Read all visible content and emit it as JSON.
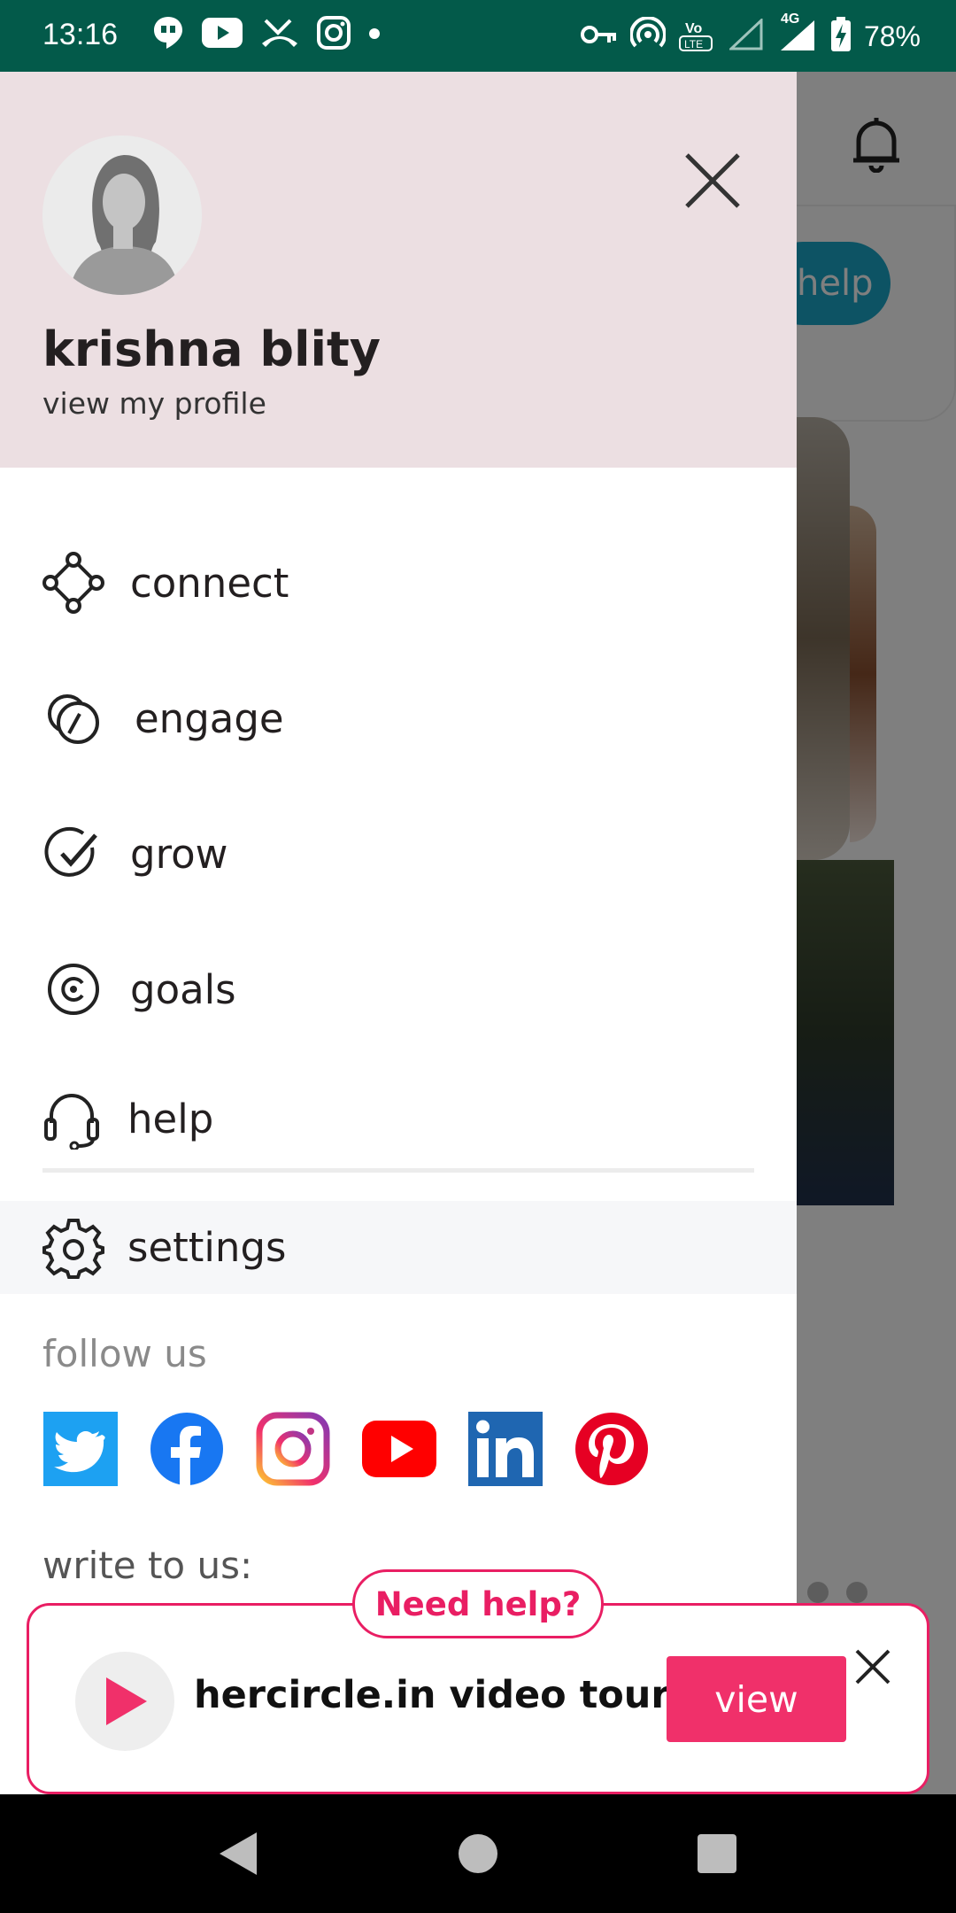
{
  "status_bar": {
    "time": "13:16",
    "battery_percent": "78%",
    "network_label": "4G",
    "left_icons": [
      "hangouts-icon",
      "youtube-icon",
      "missed-call-icon",
      "instagram-icon",
      "dot-icon"
    ],
    "right_icons": [
      "vpn-key-icon",
      "hotspot-icon",
      "volte-icon",
      "signal-icon",
      "signal-4g-icon",
      "battery-charging-icon"
    ]
  },
  "background": {
    "help_pill": "help",
    "header_icons": [
      "search-icon",
      "bell-icon"
    ]
  },
  "drawer": {
    "user_name": "krishna blity",
    "view_profile": "view my profile",
    "menu": [
      {
        "label": "connect",
        "icon": "connect-icon"
      },
      {
        "label": "engage",
        "icon": "engage-icon"
      },
      {
        "label": "grow",
        "icon": "grow-icon"
      },
      {
        "label": "goals",
        "icon": "goals-icon"
      },
      {
        "label": "help",
        "icon": "headset-icon"
      }
    ],
    "settings": {
      "label": "settings",
      "icon": "gear-icon"
    },
    "follow_us": "follow us",
    "socials": [
      {
        "name": "twitter",
        "color": "#1da1f2"
      },
      {
        "name": "facebook",
        "color": "#1877f2"
      },
      {
        "name": "instagram",
        "color": "#c13584"
      },
      {
        "name": "youtube",
        "color": "#ff0000"
      },
      {
        "name": "linkedin",
        "color": "#0a66c2"
      },
      {
        "name": "pinterest",
        "color": "#e60023"
      }
    ],
    "write_to_us": "write to us:"
  },
  "tour_banner": {
    "need_help": "Need help?",
    "title": "hercircle.in video tour",
    "view_button": "view",
    "accent_color": "#f0306a"
  },
  "nav_bar": {
    "buttons": [
      "back",
      "home",
      "recents"
    ]
  }
}
